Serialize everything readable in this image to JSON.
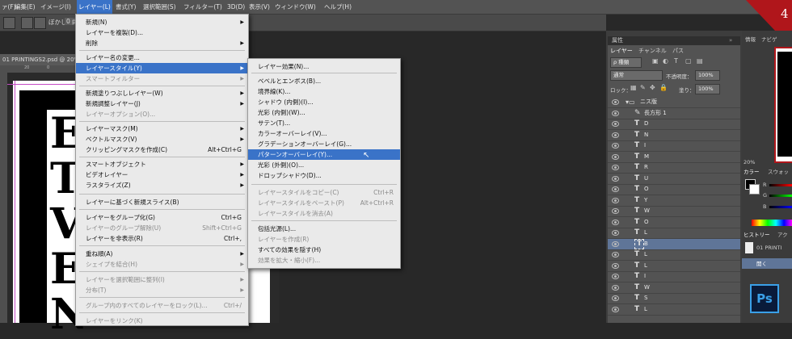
{
  "menubar": {
    "items": [
      "ァ(F)",
      "編集(E)",
      "イメージ(I)",
      "レイヤー(L)",
      "書式(Y)",
      "選択範囲(S)",
      "フィルター(T)",
      "3D(D)",
      "表示(V)",
      "ウィンドウ(W)",
      "ヘルプ(H)"
    ],
    "active": "レイヤー(L)"
  },
  "options_bar": {
    "blur_label": "ぼかし：",
    "blur_value": "0 px"
  },
  "document": {
    "tab_title": "01 PRINTINGS2.psd @ 20%",
    "ruler_ticks": [
      "20",
      "0"
    ],
    "letters": [
      "E",
      "T",
      "V",
      "E",
      "N"
    ]
  },
  "layer_menu": {
    "items": [
      {
        "label": "新規(N)",
        "shortcut": "",
        "submenu": true,
        "disabled": false
      },
      {
        "label": "レイヤーを複製(D)...",
        "shortcut": "",
        "submenu": false,
        "disabled": false
      },
      {
        "label": "削除",
        "shortcut": "",
        "submenu": true,
        "disabled": false
      },
      {
        "label": "レイヤー名の変更...",
        "shortcut": "",
        "submenu": false,
        "disabled": false
      },
      {
        "label": "レイヤースタイル(Y)",
        "shortcut": "",
        "submenu": true,
        "disabled": false,
        "highlighted": true
      },
      {
        "label": "スマートフィルター",
        "shortcut": "",
        "submenu": true,
        "disabled": true
      },
      {
        "label": "新規塗りつぶしレイヤー(W)",
        "shortcut": "",
        "submenu": true,
        "disabled": false
      },
      {
        "label": "新規調整レイヤー(J)",
        "shortcut": "",
        "submenu": true,
        "disabled": false
      },
      {
        "label": "レイヤーオプション(O)...",
        "shortcut": "",
        "submenu": false,
        "disabled": true
      },
      {
        "label": "レイヤーマスク(M)",
        "shortcut": "",
        "submenu": true,
        "disabled": false
      },
      {
        "label": "ベクトルマスク(V)",
        "shortcut": "",
        "submenu": true,
        "disabled": false
      },
      {
        "label": "クリッピングマスクを作成(C)",
        "shortcut": "Alt+Ctrl+G",
        "submenu": false,
        "disabled": false
      },
      {
        "label": "スマートオブジェクト",
        "shortcut": "",
        "submenu": true,
        "disabled": false
      },
      {
        "label": "ビデオレイヤー",
        "shortcut": "",
        "submenu": true,
        "disabled": false
      },
      {
        "label": "ラスタライズ(Z)",
        "shortcut": "",
        "submenu": true,
        "disabled": false
      },
      {
        "label": "レイヤーに基づく新規スライス(B)",
        "shortcut": "",
        "submenu": false,
        "disabled": false
      },
      {
        "label": "レイヤーをグループ化(G)",
        "shortcut": "Ctrl+G",
        "submenu": false,
        "disabled": false
      },
      {
        "label": "レイヤーのグループ解除(U)",
        "shortcut": "Shift+Ctrl+G",
        "submenu": false,
        "disabled": true
      },
      {
        "label": "レイヤーを非表示(R)",
        "shortcut": "Ctrl+,",
        "submenu": false,
        "disabled": false
      },
      {
        "label": "重ね順(A)",
        "shortcut": "",
        "submenu": true,
        "disabled": false
      },
      {
        "label": "シェイプを結合(H)",
        "shortcut": "",
        "submenu": true,
        "disabled": true
      },
      {
        "label": "レイヤーを選択範囲に整列(I)",
        "shortcut": "",
        "submenu": true,
        "disabled": true
      },
      {
        "label": "分布(T)",
        "shortcut": "",
        "submenu": true,
        "disabled": true
      },
      {
        "label": "グループ内のすべてのレイヤーをロック(L)...",
        "shortcut": "Ctrl+/",
        "submenu": false,
        "disabled": true
      },
      {
        "label": "レイヤーをリンク(K)",
        "shortcut": "",
        "submenu": false,
        "disabled": true
      }
    ]
  },
  "style_submenu": {
    "items": [
      {
        "label": "レイヤー効果(N)...",
        "shortcut": "",
        "disabled": false
      },
      {
        "label": "ベベルとエンボス(B)...",
        "shortcut": "",
        "disabled": false
      },
      {
        "label": "境界線(K)...",
        "shortcut": "",
        "disabled": false
      },
      {
        "label": "シャドウ (内側)(I)...",
        "shortcut": "",
        "disabled": false
      },
      {
        "label": "光彩 (内側)(W)...",
        "shortcut": "",
        "disabled": false
      },
      {
        "label": "サテン(T)...",
        "shortcut": "",
        "disabled": false
      },
      {
        "label": "カラーオーバーレイ(V)...",
        "shortcut": "",
        "disabled": false
      },
      {
        "label": "グラデーションオーバーレイ(G)...",
        "shortcut": "",
        "disabled": false
      },
      {
        "label": "パターンオーバーレイ(Y)...",
        "shortcut": "",
        "disabled": false,
        "highlighted": true
      },
      {
        "label": "光彩 (外側)(O)...",
        "shortcut": "",
        "disabled": false
      },
      {
        "label": "ドロップシャドウ(D)...",
        "shortcut": "",
        "disabled": false
      },
      {
        "label": "レイヤースタイルをコピー(C)",
        "shortcut": "Ctrl+R",
        "disabled": true
      },
      {
        "label": "レイヤースタイルをペースト(P)",
        "shortcut": "Alt+Ctrl+R",
        "disabled": true
      },
      {
        "label": "レイヤースタイルを消去(A)",
        "shortcut": "",
        "disabled": true
      },
      {
        "label": "包括光源(L)...",
        "shortcut": "",
        "disabled": false
      },
      {
        "label": "レイヤーを作成(R)",
        "shortcut": "",
        "disabled": true
      },
      {
        "label": "すべての効果を隠す(H)",
        "shortcut": "",
        "disabled": false
      },
      {
        "label": "効果を拡大・縮小(F)...",
        "shortcut": "",
        "disabled": true
      }
    ]
  },
  "layers_panel": {
    "header_label": "属性",
    "tabs": [
      "レイヤー",
      "チャンネル",
      "パス"
    ],
    "filter_label": "ρ 種類",
    "blend_mode": "通常",
    "opacity_label": "不透明度：",
    "opacity_value": "100%",
    "lock_label": "ロック：",
    "fill_label": "塗り：",
    "fill_value": "100%",
    "group_name": "ニス版",
    "shape_name": "長方形 1",
    "text_layers": [
      "D",
      "N",
      "I",
      "M",
      "R",
      "U",
      "O",
      "Y",
      "W",
      "O",
      "L",
      "B",
      "L",
      "L",
      "I",
      "W",
      "S",
      "L"
    ],
    "selected_index": 11,
    "text_icon": "T"
  },
  "right_column": {
    "info_tab": "情報",
    "navigator_tab": "ナビゲ",
    "zoom": "20%",
    "color_tabs": [
      "カラー",
      "スウォッ"
    ],
    "channels": [
      "R",
      "G",
      "B"
    ],
    "history_tabs": [
      "ヒストリー",
      "アク"
    ],
    "history_items": [
      "01 PRINTI",
      "開く"
    ]
  },
  "corner_badge": "4",
  "app_logo": "Ps",
  "colors": {
    "highlight": "#3a73c8",
    "badge": "#b0161b",
    "ps_blue": "#3aa0e8"
  }
}
